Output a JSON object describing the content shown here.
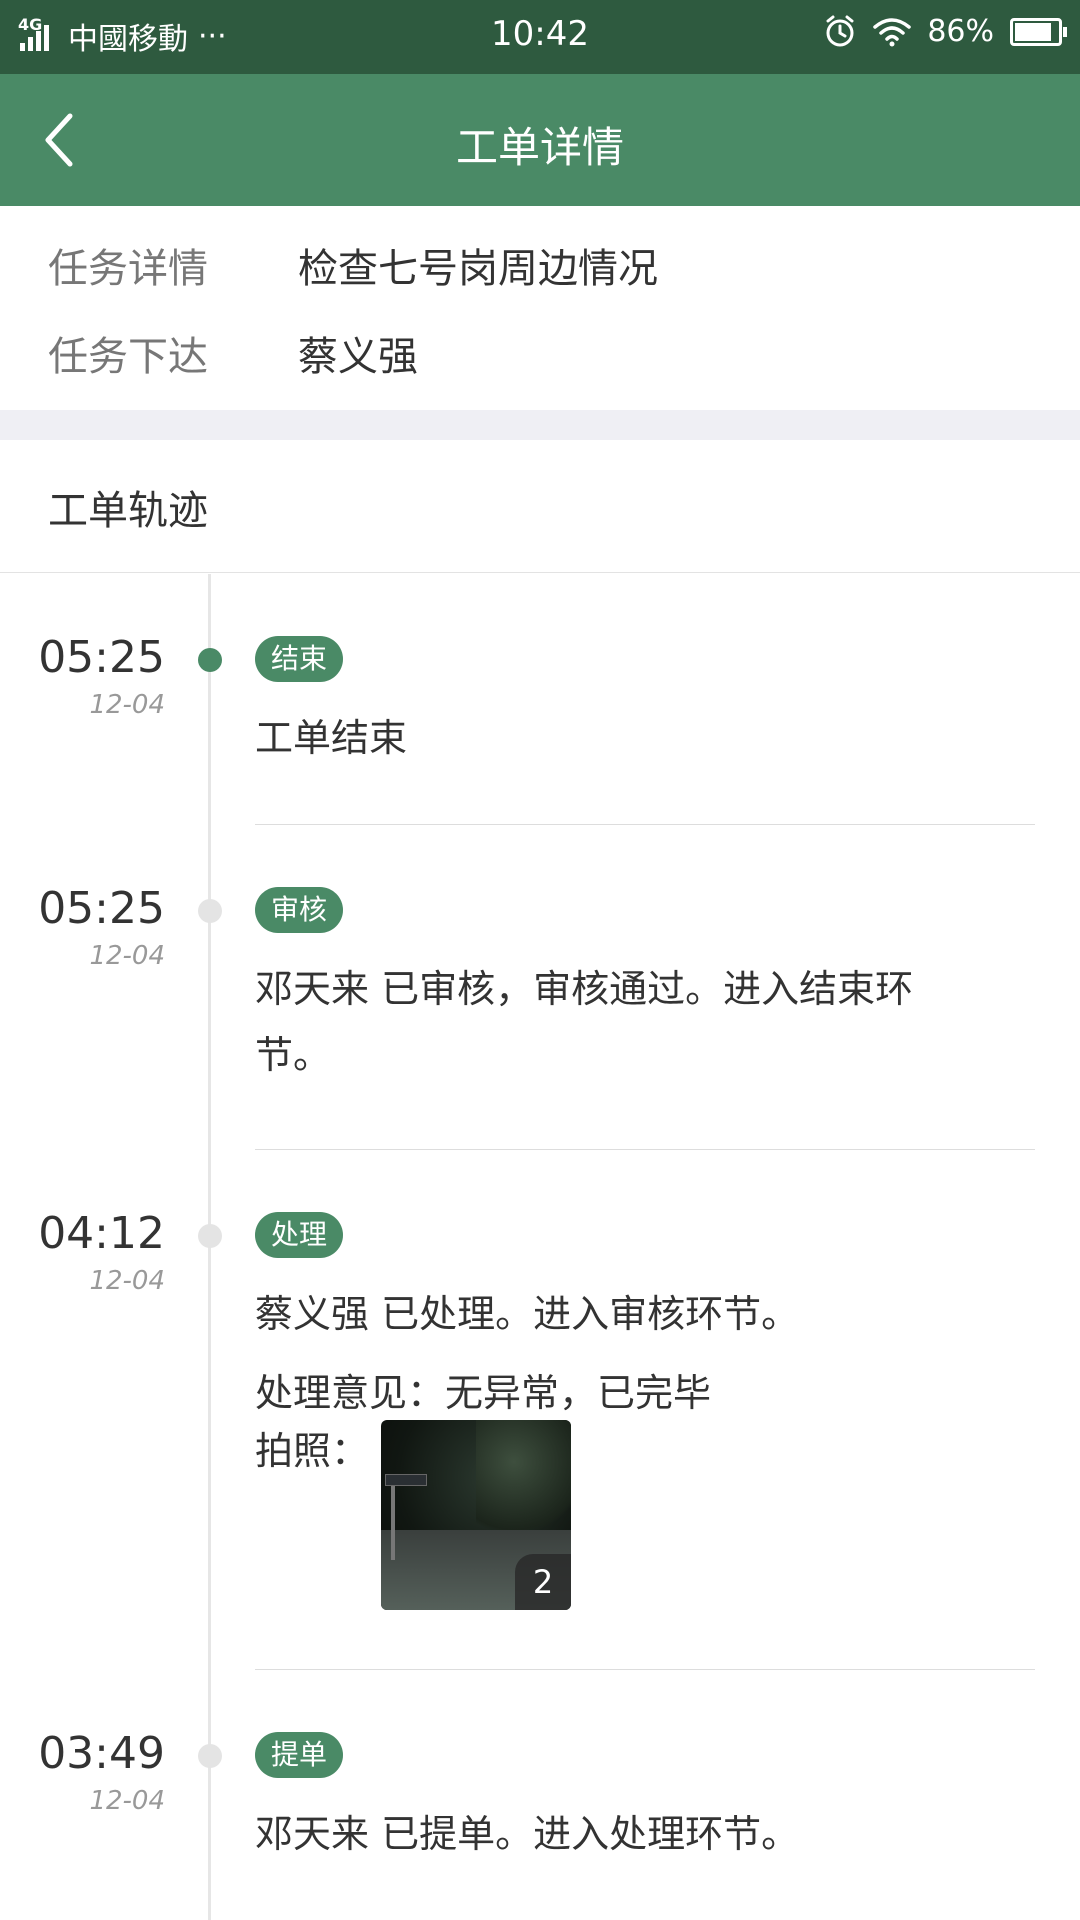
{
  "status_bar": {
    "network": "4G",
    "carrier": "中國移動",
    "more": "···",
    "time": "10:42",
    "battery_percent": "86%",
    "battery_level": 0.86,
    "icons": [
      "signal-icon",
      "alarm-icon",
      "wifi-icon",
      "battery-icon"
    ]
  },
  "nav": {
    "back_icon": "chevron-left-icon",
    "title": "工单详情"
  },
  "info": {
    "task_detail_label": "任务详情",
    "task_detail_value": "检查七号岗周边情况",
    "task_issuer_label": "任务下达",
    "task_issuer_value": "蔡义强"
  },
  "track": {
    "header": "工单轨迹",
    "entries": [
      {
        "time": "05:25",
        "date": "12-04",
        "tag": "结束",
        "text": "工单结束",
        "active": true
      },
      {
        "time": "05:25",
        "date": "12-04",
        "tag": "审核",
        "text_line1": "邓天来 已审核，审核通过。进入结束环",
        "text_line2": "节。",
        "active": false
      },
      {
        "time": "04:12",
        "date": "12-04",
        "tag": "处理",
        "text": "蔡义强 已处理。进入审核环节。",
        "opinion": "处理意见：无异常，已完毕",
        "photo_label": "拍照：",
        "photo_count": "2",
        "active": false
      },
      {
        "time": "03:49",
        "date": "12-04",
        "tag": "提单",
        "text": "邓天来 已提单。进入处理环节。",
        "active": false
      }
    ]
  },
  "colors": {
    "status_bar": "#2e5a3f",
    "nav_bar": "#4a8a66",
    "accent": "#4a8a66",
    "inactive_dot": "#e4e4e4"
  }
}
